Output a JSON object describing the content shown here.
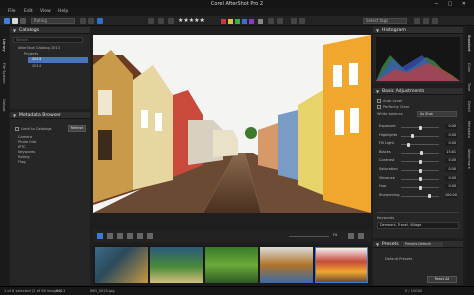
{
  "window": {
    "title": "Corel AfterShot Pro 2"
  },
  "menu": [
    "File",
    "Edit",
    "View",
    "Help"
  ],
  "toolbar": {
    "filter_select": "Rating",
    "stars": "★★★★★",
    "search_placeholder": "Select tags"
  },
  "left_tabs": [
    "Library",
    "File System",
    "Output"
  ],
  "catalogs": {
    "title": "Catalogs",
    "search_placeholder": "Search",
    "items": [
      "AfterShot Catalog 2013",
      "Projects",
      "2013",
      "2014"
    ]
  },
  "metadata": {
    "title": "Metadata Browser",
    "checkbox_label": "Limit to Catalogs",
    "refresh_button": "Refresh",
    "items": [
      "Camera",
      "Photo Info",
      "IPTC",
      "Keywords",
      "Rating",
      "Flag"
    ]
  },
  "right_tabs": [
    "Standard",
    "Color",
    "Tone",
    "Detail",
    "Metadata",
    "Watermark"
  ],
  "histogram": {
    "title": "Histogram"
  },
  "basic": {
    "title": "Basic Adjustments",
    "auto_level": "Auto Level",
    "perfectly_clear": "Perfectly Clear",
    "white_balance": "White balance",
    "wb_value": "As Shot",
    "sliders": [
      {
        "label": "Exposure",
        "value": "0.00",
        "pos": 0.5
      },
      {
        "label": "Highlights",
        "value": "0.00",
        "pos": 0.3
      },
      {
        "label": "Fill Light",
        "value": "0.00",
        "pos": 0.2
      },
      {
        "label": "Blacks",
        "value": "15.61",
        "pos": 0.55
      },
      {
        "label": "Contrast",
        "value": "0.00",
        "pos": 0.5
      },
      {
        "label": "Saturation",
        "value": "0.00",
        "pos": 0.5
      },
      {
        "label": "Vibrance",
        "value": "0.00",
        "pos": 0.5
      },
      {
        "label": "Hue",
        "value": "0.00",
        "pos": 0.5
      },
      {
        "label": "Sharpening",
        "value": "100.00",
        "pos": 0.75
      }
    ],
    "keywords_label": "Keywords",
    "keywords_value": "Denmark, Travel, Village"
  },
  "presets": {
    "title": "Presets",
    "select": "Presets Default",
    "items": [
      "Default Presets"
    ],
    "reset_button": "Reset All"
  },
  "viewer_toolbar": {
    "zoom_label": "Fit"
  },
  "status": {
    "left": "1 of 8 selected (2 of 56 images)",
    "path": "2013",
    "file": "IMG_0025.jpg",
    "right": "0 / 10000"
  },
  "colors": {
    "accent": "#2a6fd8",
    "panel": "#262626",
    "bg": "#1e1e1e"
  }
}
